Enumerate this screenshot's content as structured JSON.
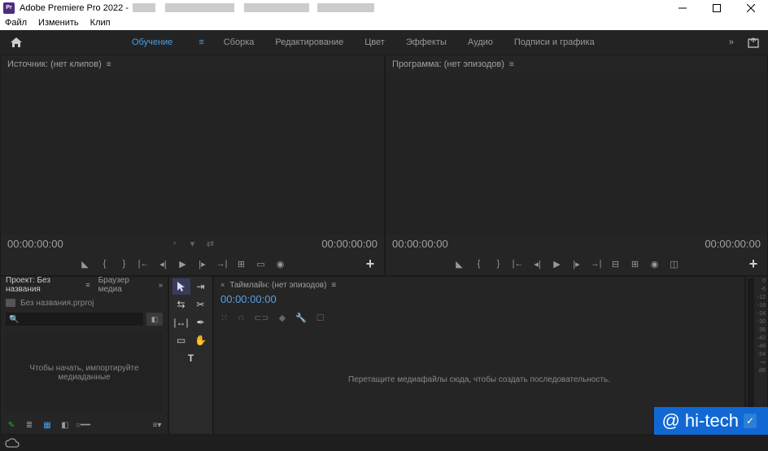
{
  "titlebar": {
    "app_title": "Adobe Premiere Pro 2022 -"
  },
  "menubar": {
    "file": "Файл",
    "edit": "Изменить",
    "clip": "Клип"
  },
  "workspace": {
    "learning": "Обучение",
    "assembly": "Сборка",
    "editing": "Редактирование",
    "color": "Цвет",
    "effects": "Эффекты",
    "audio": "Аудио",
    "graphics": "Подписи и графика"
  },
  "source": {
    "title": "Источник: (нет клипов)",
    "tc_left": "00:00:00:00",
    "tc_right": "00:00:00:00"
  },
  "program": {
    "title": "Программа: (нет эпизодов)",
    "tc_left": "00:00:00:00",
    "tc_right": "00:00:00:00"
  },
  "project": {
    "tab_project": "Проект: Без названия",
    "tab_media": "Браузер медиа",
    "filename": "Без названия.prproj",
    "search_placeholder": "",
    "import_hint": "Чтобы начать, импортируйте медиаданные"
  },
  "timeline": {
    "title": "Таймлайн: (нет эпизодов)",
    "tc": "00:00:00:00",
    "hint": "Перетащите медиафайлы сюда, чтобы создать последовательность."
  },
  "meters": {
    "labels": [
      "0",
      "-6",
      "-12",
      "-18",
      "-24",
      "-30",
      "-36",
      "-42",
      "-48",
      "-54",
      "-∞",
      "dB"
    ]
  },
  "watermark": "hi-tech"
}
